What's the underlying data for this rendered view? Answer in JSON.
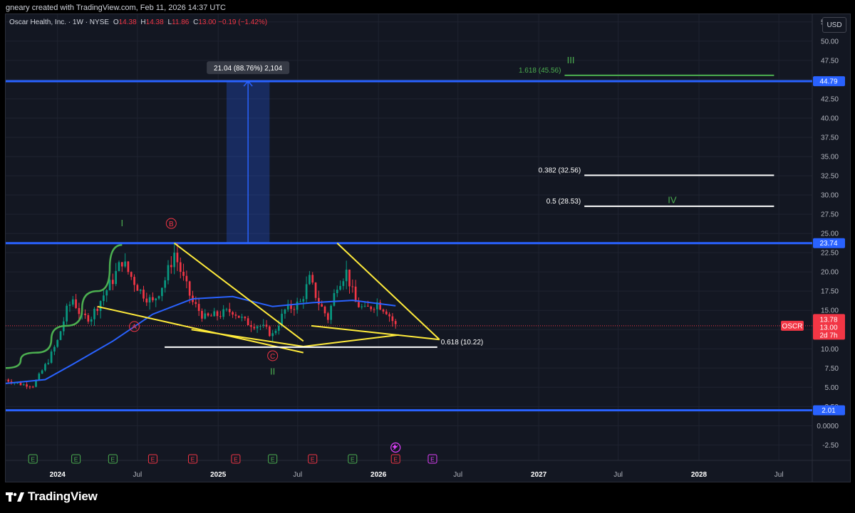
{
  "attribution": "gneary created with TradingView.com, Feb 11, 2026 14:37 UTC",
  "legend": {
    "symbol": "Oscar Health, Inc. · 1W · NYSE",
    "open_label": "O",
    "open": "14.38",
    "high_label": "H",
    "high": "14.38",
    "low_label": "L",
    "low": "11.86",
    "close_label": "C",
    "close": "13.00",
    "change": "−0.19 (−1.42%)"
  },
  "currency": "USD",
  "footer": {
    "brand": "TradingView"
  },
  "colors": {
    "up": "#089981",
    "down": "#f23645",
    "ma": "#2962ff",
    "hline": "#2962ff",
    "trend": "#ffeb3b",
    "wave_green": "#4caf50",
    "wave_red": "#f23645",
    "fib_white": "#ffffff",
    "grid": "#1f2330",
    "axis_text": "#b2b5be"
  },
  "chart_data": {
    "type": "candlestick",
    "y_ticks": [
      "-2.50",
      "0.0000",
      "2.50",
      "5.00",
      "7.50",
      "10.00",
      "12.50",
      "15.00",
      "17.50",
      "20.00",
      "22.50",
      "25.00",
      "27.50",
      "30.00",
      "32.50",
      "35.00",
      "37.50",
      "40.00",
      "42.50",
      "45.00",
      "47.50",
      "50.00",
      "52.50"
    ],
    "ylim": [
      -4.5,
      53.5
    ],
    "x_ticks": [
      {
        "label": "2024",
        "date": "2024-01-01",
        "bold": true
      },
      {
        "label": "Jul",
        "date": "2024-07-01",
        "bold": false
      },
      {
        "label": "2025",
        "date": "2025-01-01",
        "bold": true
      },
      {
        "label": "Jul",
        "date": "2025-07-01",
        "bold": false
      },
      {
        "label": "2026",
        "date": "2026-01-01",
        "bold": true
      },
      {
        "label": "Jul",
        "date": "2026-07-01",
        "bold": false
      },
      {
        "label": "2027",
        "date": "2027-01-01",
        "bold": true
      },
      {
        "label": "Jul",
        "date": "2027-07-01",
        "bold": false
      },
      {
        "label": "2028",
        "date": "2028-01-01",
        "bold": true
      },
      {
        "label": "Jul",
        "date": "2028-07-01",
        "bold": false
      }
    ],
    "xlim": [
      "2023-09-05",
      "2028-09-15"
    ],
    "price_path": [
      [
        "2023-09-04",
        6.0
      ],
      [
        "2023-10-09",
        5.4
      ],
      [
        "2023-11-06",
        5.2
      ],
      [
        "2023-11-20",
        6.5
      ],
      [
        "2023-12-11",
        8.5
      ],
      [
        "2024-01-01",
        11.0
      ],
      [
        "2024-01-22",
        15.0
      ],
      [
        "2024-02-05",
        16.5
      ],
      [
        "2024-02-26",
        14.0
      ],
      [
        "2024-03-18",
        14.2
      ],
      [
        "2024-04-15",
        17.0
      ],
      [
        "2024-05-06",
        19.0
      ],
      [
        "2024-05-27",
        21.5
      ],
      [
        "2024-06-10",
        20.0
      ],
      [
        "2024-07-08",
        17.5
      ],
      [
        "2024-08-05",
        16.0
      ],
      [
        "2024-09-02",
        19.0
      ],
      [
        "2024-09-23",
        22.5
      ],
      [
        "2024-10-14",
        19.0
      ],
      [
        "2024-11-04",
        16.0
      ],
      [
        "2024-12-02",
        14.0
      ],
      [
        "2025-01-06",
        14.5
      ],
      [
        "2025-02-03",
        15.0
      ],
      [
        "2025-03-03",
        13.5
      ],
      [
        "2025-04-07",
        13.0
      ],
      [
        "2025-05-05",
        11.8
      ],
      [
        "2025-06-02",
        15.0
      ],
      [
        "2025-07-07",
        16.0
      ],
      [
        "2025-07-28",
        19.0
      ],
      [
        "2025-08-18",
        16.0
      ],
      [
        "2025-09-08",
        14.0
      ],
      [
        "2025-09-29",
        18.5
      ],
      [
        "2025-10-20",
        20.0
      ],
      [
        "2025-11-10",
        16.0
      ],
      [
        "2025-12-01",
        15.0
      ],
      [
        "2025-12-29",
        16.0
      ],
      [
        "2026-01-19",
        15.0
      ],
      [
        "2026-02-09",
        13.0
      ]
    ],
    "moving_average": [
      [
        "2023-09-04",
        5.5
      ],
      [
        "2023-12-04",
        6.0
      ],
      [
        "2024-02-05",
        8.0
      ],
      [
        "2024-05-06",
        11.0
      ],
      [
        "2024-08-05",
        14.5
      ],
      [
        "2024-11-04",
        16.5
      ],
      [
        "2025-02-03",
        16.8
      ],
      [
        "2025-05-05",
        15.5
      ],
      [
        "2025-08-04",
        16.0
      ],
      [
        "2025-11-03",
        16.3
      ],
      [
        "2026-02-09",
        15.6
      ]
    ],
    "horizontal_lines": [
      {
        "value": 44.79,
        "label": "44.79"
      },
      {
        "value": 23.74,
        "label": "23.74"
      },
      {
        "value": 2.01,
        "label": "2.01"
      }
    ],
    "price_scale_labels": [
      {
        "value": 13.78,
        "label": "13.78"
      },
      {
        "value": 13.0,
        "label": "13.00"
      },
      {
        "label": "2d 7h"
      }
    ],
    "symbol_label": "OSCR",
    "dotted_price": 13.0,
    "fib_levels": [
      {
        "label": "1.618 (45.56)",
        "value": 45.56,
        "from": "2027-03-01",
        "to": "2028-06-20"
      },
      {
        "label": "0.382 (32.56)",
        "value": 32.56,
        "from": "2027-04-15",
        "to": "2028-06-20"
      },
      {
        "label": "0.5 (28.53)",
        "value": 28.53,
        "from": "2027-04-15",
        "to": "2028-06-20"
      },
      {
        "label": "0.618 (10.22)",
        "value": 10.22,
        "from": "2024-09-01",
        "to": "2026-05-15"
      }
    ],
    "measure": {
      "label": "21.04 (88.76%) 2,104",
      "from_date": "2025-01-20",
      "to_date": "2025-04-28",
      "low": 23.74,
      "high": 44.79,
      "arrow_date": "2025-03-10"
    },
    "trendlines": [
      {
        "a": [
          "2024-09-23",
          23.74
        ],
        "b": [
          "2025-07-14",
          11.0
        ]
      },
      {
        "a": [
          "2024-04-01",
          15.5
        ],
        "b": [
          "2025-07-14",
          9.5
        ]
      },
      {
        "a": [
          "2025-09-29",
          23.74
        ],
        "b": [
          "2026-05-20",
          11.2
        ]
      },
      {
        "a": [
          "2025-08-01",
          13.0
        ],
        "b": [
          "2026-05-20",
          11.2
        ]
      },
      {
        "a": [
          "2024-11-01",
          12.5
        ],
        "b": [
          "2025-07-14",
          10.3
        ]
      },
      {
        "a": [
          "2025-07-14",
          10.3
        ],
        "b": [
          "2026-02-16",
          11.8
        ]
      }
    ],
    "wave_curves": [
      {
        "points": [
          [
            "2023-09-04",
            7.5
          ],
          [
            "2023-11-13",
            9.5
          ],
          [
            "2024-01-22",
            13.0
          ],
          [
            "2024-04-01",
            17.5
          ],
          [
            "2024-05-27",
            23.5
          ]
        ]
      }
    ],
    "wave_labels": [
      {
        "text": "I",
        "date": "2024-05-27",
        "value": 26.3,
        "color": "green",
        "circled": false
      },
      {
        "text": "B",
        "date": "2024-09-16",
        "value": 26.3,
        "color": "red",
        "circled": true
      },
      {
        "text": "A",
        "date": "2024-06-24",
        "value": 12.9,
        "color": "red",
        "circled": true
      },
      {
        "text": "C",
        "date": "2025-05-05",
        "value": 9.1,
        "color": "red",
        "circled": true
      },
      {
        "text": "II",
        "date": "2025-05-05",
        "value": 7.0,
        "color": "green",
        "circled": false
      },
      {
        "text": "III",
        "date": "2027-03-15",
        "value": 47.5,
        "color": "green",
        "circled": false
      },
      {
        "text": "IV",
        "date": "2027-11-01",
        "value": 29.3,
        "color": "green",
        "circled": false
      }
    ],
    "earnings_markers": [
      {
        "date": "2023-11-06",
        "color": "green"
      },
      {
        "date": "2024-02-12",
        "color": "green"
      },
      {
        "date": "2024-05-06",
        "color": "green"
      },
      {
        "date": "2024-08-05",
        "color": "red"
      },
      {
        "date": "2024-11-04",
        "color": "red"
      },
      {
        "date": "2025-02-10",
        "color": "red"
      },
      {
        "date": "2025-05-05",
        "color": "green"
      },
      {
        "date": "2025-08-04",
        "color": "red"
      },
      {
        "date": "2025-11-03",
        "color": "green"
      },
      {
        "date": "2026-02-09",
        "color": "red"
      },
      {
        "date": "2026-05-04",
        "color": "purple"
      }
    ],
    "event_marker_date": "2026-02-09",
    "earnings_text": "E"
  }
}
